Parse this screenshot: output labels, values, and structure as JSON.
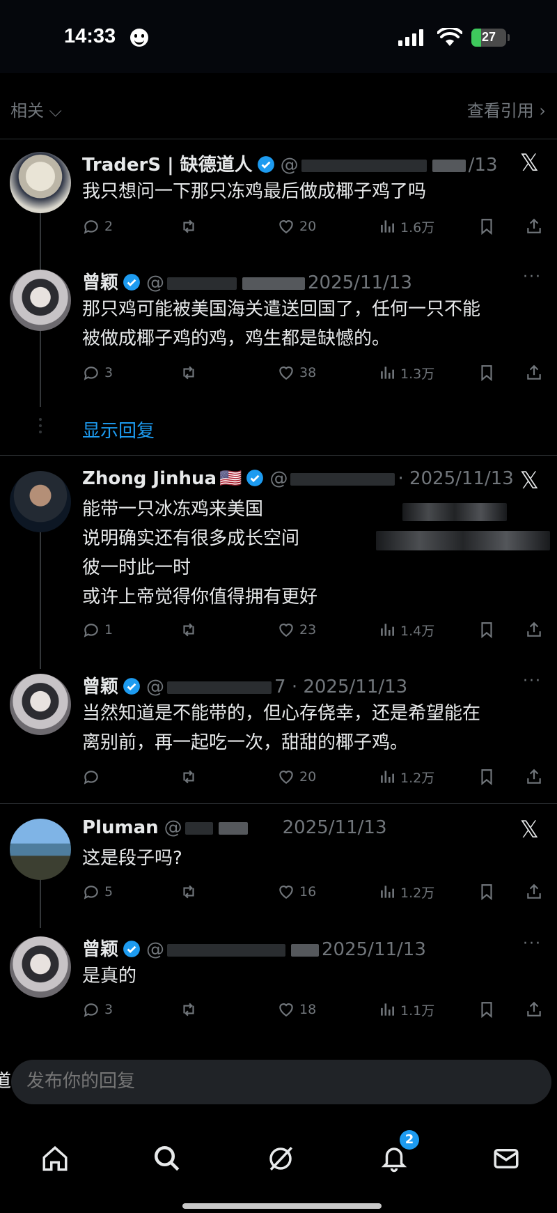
{
  "status": {
    "time": "14:33",
    "battery": "27",
    "battery_level": 0.27
  },
  "nav": {
    "related_label": "相关",
    "view_quotes_label": "查看引用"
  },
  "posts": [
    {
      "name": "TraderS | 缺德道人",
      "handle": "@",
      "date": "/13",
      "lines": [
        "我只想问一下那只冻鸡最后做成椰子鸡了吗"
      ],
      "reply": "2",
      "like": "20",
      "views": "1.6万",
      "corner": "x"
    },
    {
      "name": "曾颖",
      "handle": "@",
      "date": "2025/11/13",
      "lines": [
        "那只鸡可能被美国海关遣送回国了，任何一只不能",
        "被做成椰子鸡的鸡，鸡生都是缺憾的。"
      ],
      "reply": "3",
      "like": "38",
      "views": "1.3万",
      "corner": "more"
    },
    {
      "name": "Zhong Jinhua",
      "flag": "🇺🇸",
      "handle": "@",
      "date": "· 2025/11/13",
      "lines": [
        "能带一只冰冻鸡来美国",
        "说明确实还有很多成长空间",
        "彼一时此一时",
        "或许上帝觉得你值得拥有更好"
      ],
      "reply": "1",
      "like": "23",
      "views": "1.4万",
      "corner": "x"
    },
    {
      "name": "曾颖",
      "handle": "@",
      "date": "7 · 2025/11/13",
      "lines": [
        "当然知道是不能带的，但心存侥幸，还是希望能在",
        "离别前，再一起吃一次，甜甜的椰子鸡。"
      ],
      "reply": "",
      "like": "20",
      "views": "1.2万",
      "corner": "more"
    },
    {
      "name": "Pluman",
      "handle": "@",
      "date": "2025/11/13",
      "lines": [
        "这是段子吗?"
      ],
      "reply": "5",
      "like": "16",
      "views": "1.2万",
      "corner": "x"
    },
    {
      "name": "曾颖",
      "handle": "@",
      "date": "2025/11/13",
      "lines": [
        "是真的"
      ],
      "reply": "3",
      "like": "18",
      "views": "1.1万",
      "corner": "more"
    }
  ],
  "show_replies": "显示回复",
  "reply_bar": {
    "placeholder": "发布你的回复",
    "edge_char": "道"
  },
  "bottom_nav": {
    "notification_count": "2"
  },
  "colors": {
    "accent": "#1d9bf0",
    "muted": "#71767b",
    "background": "#000000"
  }
}
